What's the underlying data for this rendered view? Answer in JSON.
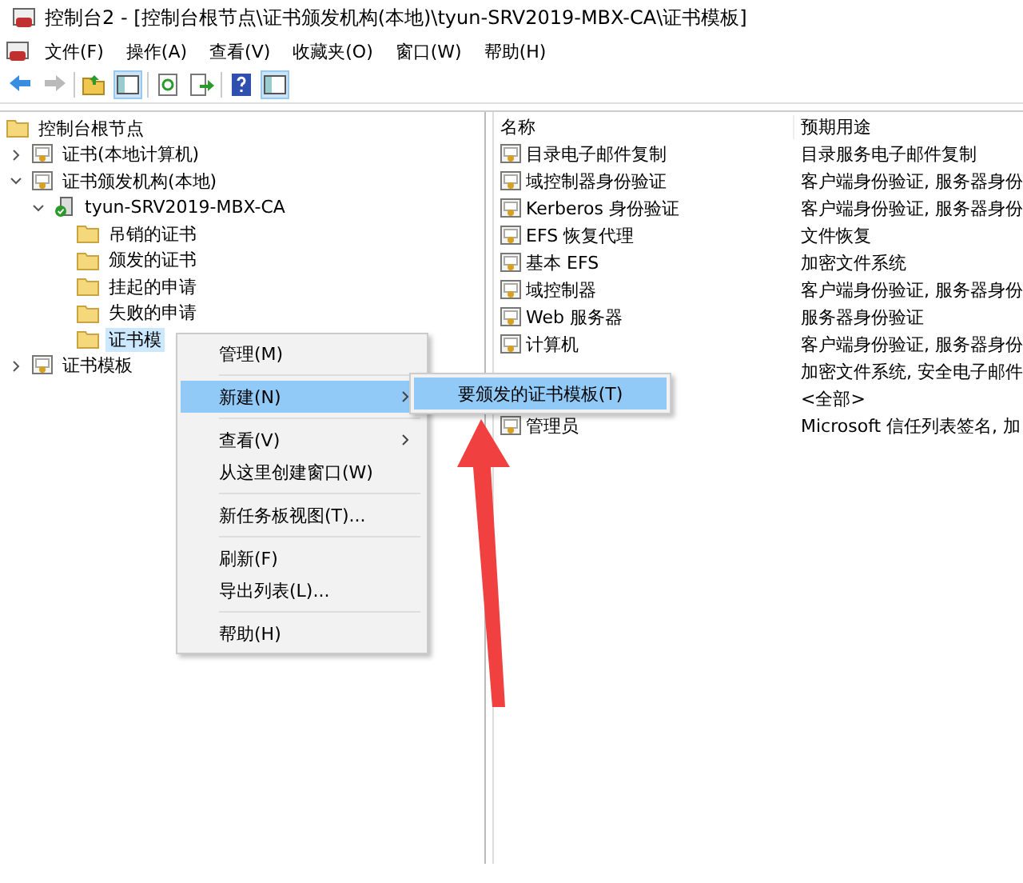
{
  "window": {
    "title": "控制台2 - [控制台根节点\\证书颁发机构(本地)\\tyun-SRV2019-MBX-CA\\证书模板]"
  },
  "menu_bar": [
    "文件(F)",
    "操作(A)",
    "查看(V)",
    "收藏夹(O)",
    "窗口(W)",
    "帮助(H)"
  ],
  "toolbar": [
    {
      "kind": "back",
      "disabled": false,
      "selected": false
    },
    {
      "kind": "forward",
      "disabled": true,
      "selected": false
    },
    {
      "kind": "sep"
    },
    {
      "kind": "up",
      "disabled": false,
      "selected": false
    },
    {
      "kind": "pane",
      "disabled": false,
      "selected": true
    },
    {
      "kind": "sep"
    },
    {
      "kind": "refresh",
      "disabled": false,
      "selected": false
    },
    {
      "kind": "export",
      "disabled": false,
      "selected": false
    },
    {
      "kind": "sep"
    },
    {
      "kind": "help",
      "disabled": false,
      "selected": false
    },
    {
      "kind": "pane",
      "disabled": false,
      "selected": true
    }
  ],
  "tree": [
    {
      "label": "控制台根节点",
      "kind": "folder",
      "selected": false,
      "children": [
        {
          "label": "证书(本地计算机)",
          "kind": "cert",
          "expanded": false,
          "selected": false
        },
        {
          "label": "证书颁发机构(本地)",
          "kind": "cert",
          "expanded": true,
          "selected": false,
          "children": [
            {
              "label": "tyun-SRV2019-MBX-CA",
              "kind": "server",
              "expanded": true,
              "selected": false,
              "children": [
                {
                  "label": "吊销的证书",
                  "kind": "folder",
                  "selected": false
                },
                {
                  "label": "颁发的证书",
                  "kind": "folder",
                  "selected": false
                },
                {
                  "label": "挂起的申请",
                  "kind": "folder",
                  "selected": false
                },
                {
                  "label": "失败的申请",
                  "kind": "folder",
                  "selected": false
                },
                {
                  "label": "证书模",
                  "kind": "folder",
                  "selected": true
                }
              ]
            }
          ]
        },
        {
          "label": "证书模板",
          "kind": "cert",
          "expanded": false,
          "selected": false
        }
      ]
    }
  ],
  "table": {
    "columns": [
      "名称",
      "预期用途"
    ],
    "rows": [
      {
        "name": "目录电子邮件复制",
        "purpose": "目录服务电子邮件复制"
      },
      {
        "name": "域控制器身份验证",
        "purpose": "客户端身份验证, 服务器身份"
      },
      {
        "name": "Kerberos 身份验证",
        "purpose": "客户端身份验证, 服务器身份"
      },
      {
        "name": "EFS 恢复代理",
        "purpose": "文件恢复"
      },
      {
        "name": "基本 EFS",
        "purpose": "加密文件系统"
      },
      {
        "name": "域控制器",
        "purpose": "客户端身份验证, 服务器身份"
      },
      {
        "name": "Web 服务器",
        "purpose": "服务器身份验证"
      },
      {
        "name": "计算机",
        "purpose": "客户端身份验证, 服务器身份"
      },
      {
        "purpose": "加密文件系统, 安全电子邮件"
      },
      {
        "purpose": "<全部>"
      },
      {
        "name": "管理员",
        "purpose": "Microsoft 信任列表签名, 加"
      }
    ]
  },
  "context_menu": [
    {
      "kind": "item",
      "label": "管理(M)",
      "selected": false
    },
    {
      "kind": "separator"
    },
    {
      "kind": "submenu",
      "label": "新建(N)",
      "selected": true
    },
    {
      "kind": "separator"
    },
    {
      "kind": "submenu",
      "label": "查看(V)",
      "selected": false
    },
    {
      "kind": "item",
      "label": "从这里创建窗口(W)",
      "selected": false
    },
    {
      "kind": "separator"
    },
    {
      "kind": "item",
      "label": "新任务板视图(T)...",
      "selected": false
    },
    {
      "kind": "separator"
    },
    {
      "kind": "item",
      "label": "刷新(F)",
      "selected": false
    },
    {
      "kind": "item",
      "label": "导出列表(L)...",
      "selected": false
    },
    {
      "kind": "separator"
    },
    {
      "kind": "item",
      "label": "帮助(H)",
      "selected": false
    }
  ],
  "submenu": [
    {
      "label": "要颁发的证书模板(T)",
      "selected": true
    }
  ]
}
